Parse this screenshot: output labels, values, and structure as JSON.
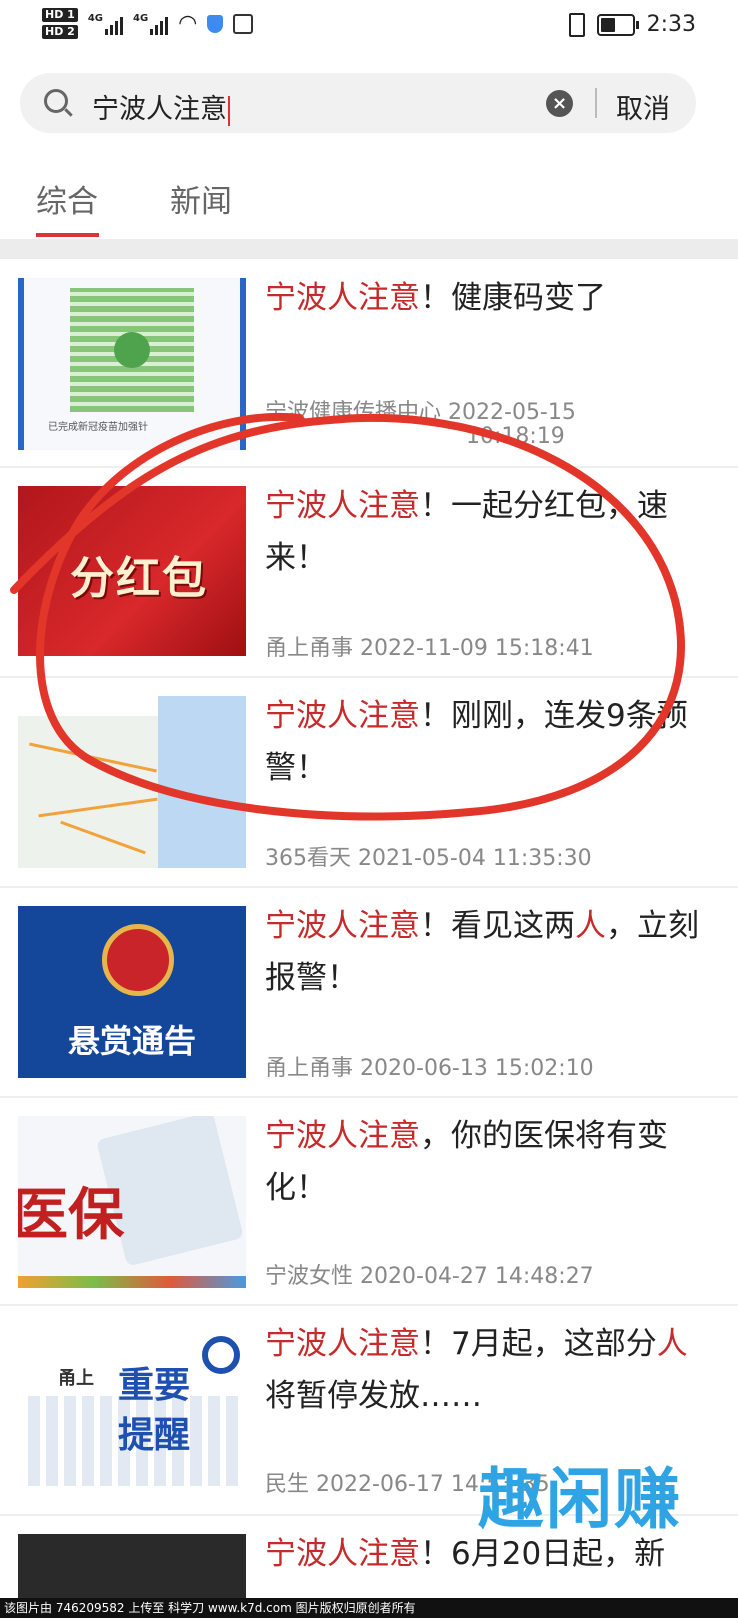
{
  "status_bar": {
    "hd1": "HD 1",
    "hd2": "HD 2",
    "net1": "4G",
    "net2": "4G",
    "time": "2:33"
  },
  "search": {
    "query": "宁波人注意",
    "cancel_label": "取消"
  },
  "tabs": [
    {
      "label": "综合",
      "active": true
    },
    {
      "label": "新闻",
      "active": false
    }
  ],
  "results": [
    {
      "highlight": "宁波人注意",
      "title_rest": "！健康码变了",
      "source": "宁波健康传播中心",
      "date": "2022-05-15",
      "time": "10:18:19",
      "thumb_caption": "已完成新冠疫苗加强针"
    },
    {
      "highlight": "宁波人注意",
      "title_rest": "！一起分红包，速来！",
      "source": "甬上甬事",
      "date": "2022-11-09",
      "time": "15:18:41",
      "thumb_text": "分红包"
    },
    {
      "highlight": "宁波人注意",
      "title_rest": "！刚刚，连发9条预警！",
      "source": "365看天",
      "date": "2021-05-04",
      "time": "11:35:30"
    },
    {
      "highlight": "宁波人注意",
      "title_rest": "！看见这两",
      "title_hl2": "人",
      "title_rest2": "，立刻报警！",
      "source": "甬上甬事",
      "date": "2020-06-13",
      "time": "15:02:10",
      "thumb_text": "悬赏通告"
    },
    {
      "highlight": "宁波人注意",
      "title_rest": "，你的医保将有变化！",
      "source": "宁波女性",
      "date": "2020-04-27",
      "time": "14:48:27",
      "thumb_text": "医保"
    },
    {
      "highlight": "宁波人注意",
      "title_rest": "！7月起，这部分",
      "title_hl2": "人",
      "title_rest2": "将暂停发放……",
      "source": "民生",
      "date": "2022-06-17",
      "time": "14:53:35",
      "thumb_logo": "甬上",
      "thumb_line1": "重要",
      "thumb_line2": "提醒"
    },
    {
      "highlight": "宁波人注意",
      "title_rest": "！6月20日起，新"
    }
  ],
  "watermark": "趣闲赚",
  "footer": "该图片由 746209582 上传至 科学刀 www.k7d.com 图片版权归原创者所有",
  "colors": {
    "accent": "#c62a2a",
    "annotation": "#e2362a",
    "watermark": "#2ea4e4"
  }
}
